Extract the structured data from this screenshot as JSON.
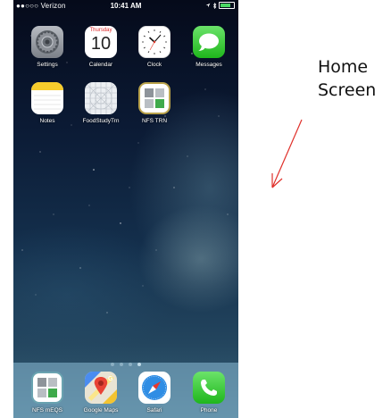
{
  "status_bar": {
    "carrier": "●●○○○ Verizon",
    "time": "10:41 AM"
  },
  "home_apps": [
    {
      "label": "Settings",
      "icon": "settings-icon"
    },
    {
      "label": "Calendar",
      "icon": "calendar-icon",
      "day": "Thursday",
      "date": "10"
    },
    {
      "label": "Clock",
      "icon": "clock-icon"
    },
    {
      "label": "Messages",
      "icon": "messages-icon"
    },
    {
      "label": "Notes",
      "icon": "notes-icon"
    },
    {
      "label": "FoodStudyTrn",
      "icon": "foodstudy-icon"
    },
    {
      "label": "NFS TRN",
      "icon": "nfs-trn-icon"
    }
  ],
  "page_dots": {
    "count": 4,
    "active": 4
  },
  "dock_apps": [
    {
      "label": "NFS mEQS",
      "icon": "nfs-meqs-icon"
    },
    {
      "label": "Google Maps",
      "icon": "google-maps-icon"
    },
    {
      "label": "Safari",
      "icon": "safari-icon"
    },
    {
      "label": "Phone",
      "icon": "phone-icon"
    }
  ],
  "annotation": {
    "line1": "Home",
    "line2": "Screen",
    "arrow_color": "#e0302a"
  }
}
